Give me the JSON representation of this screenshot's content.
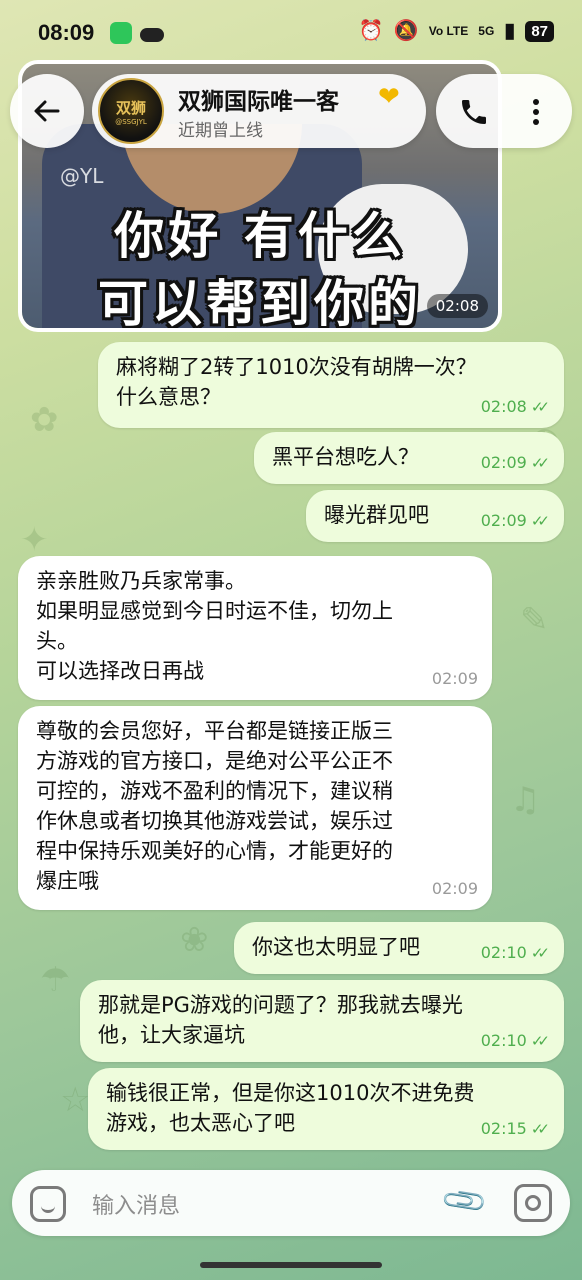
{
  "status_bar": {
    "time": "08:09",
    "network": "5G",
    "volte": "Vo LTE",
    "battery": "87"
  },
  "header": {
    "contact_name": "双狮国际唯一客",
    "status": "近期曾上线",
    "avatar_text_main": "双狮",
    "avatar_text_sub": "@SSGJYL"
  },
  "image_message": {
    "watermark": "@YL",
    "caption_line1": "你好 有什么",
    "caption_line2": "可以帮到你的",
    "time": "02:08"
  },
  "messages": [
    {
      "direction": "out",
      "text": "麻将糊了2转了1010次没有胡牌一次？\n什么意思？",
      "time": "02:08",
      "status": "read"
    },
    {
      "direction": "out",
      "text": "黑平台想吃人？",
      "time": "02:09",
      "status": "read"
    },
    {
      "direction": "out",
      "text": "曝光群见吧",
      "time": "02:09",
      "status": "read"
    },
    {
      "direction": "in",
      "text": "亲亲胜败乃兵家常事。\n如果明显感觉到今日时运不佳，切勿上\n头。\n可以选择改日再战",
      "time": "02:09"
    },
    {
      "direction": "in",
      "text": "尊敬的会员您好，平台都是链接正版三\n方游戏的官方接口，是绝对公平公正不\n可控的，游戏不盈利的情况下，建议稍\n作休息或者切换其他游戏尝试，娱乐过\n程中保持乐观美好的心情，才能更好的\n爆庄哦",
      "time": "02:09"
    },
    {
      "direction": "out",
      "text": "你这也太明显了吧",
      "time": "02:10",
      "status": "read"
    },
    {
      "direction": "out",
      "text": "那就是PG游戏的问题了？那我就去曝光\n他，让大家逼坑",
      "time": "02:10",
      "status": "read"
    },
    {
      "direction": "out",
      "text": "输钱很正常，但是你这1010次不进免费\n游戏，也太恶心了吧",
      "time": "02:15",
      "status": "read"
    }
  ],
  "composer": {
    "placeholder": "输入消息"
  },
  "colors": {
    "outgoing_bubble": "#eefcdc",
    "incoming_bubble": "#ffffff",
    "read_tick": "#4fae4e"
  }
}
